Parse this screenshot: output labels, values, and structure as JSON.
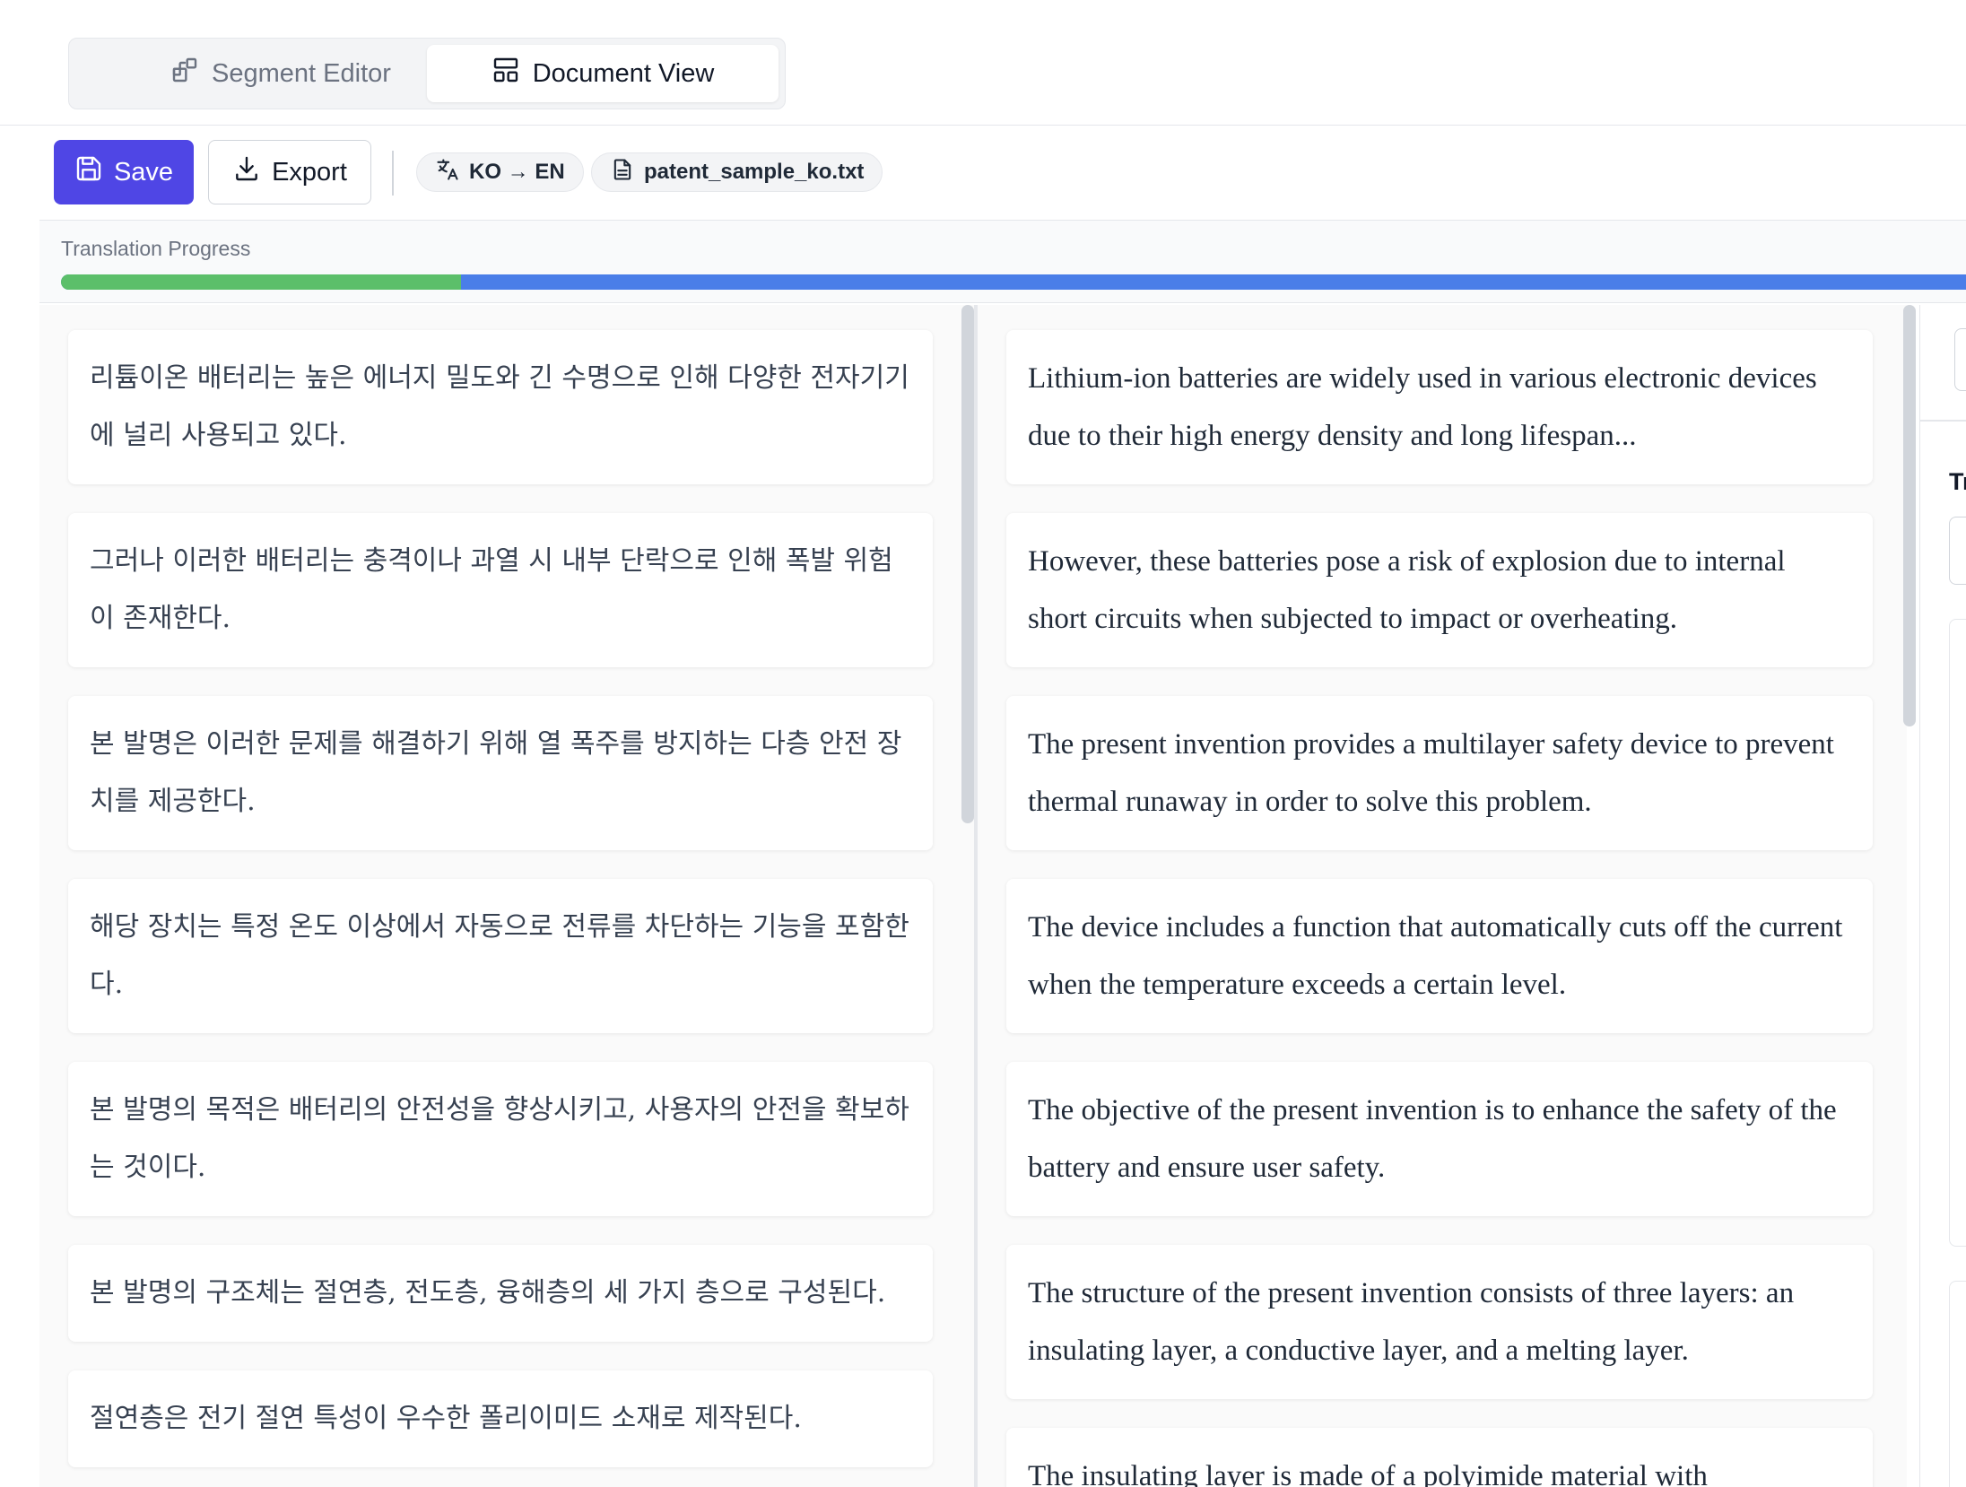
{
  "tabs": {
    "segment_editor": {
      "label": "Segment Editor",
      "icon": "segment-grid-icon"
    },
    "document_view": {
      "label": "Document View",
      "icon": "document-layout-icon",
      "active": true
    }
  },
  "toolbar": {
    "save_label": "Save",
    "export_label": "Export",
    "language_pair": "KO → EN",
    "file_name": "patent_sample_ko.txt"
  },
  "progress": {
    "label": "Translation Progress",
    "completed_fraction": 0.21
  },
  "colors": {
    "accent": "#4f46e5",
    "progress_done": "#5cbf6a",
    "progress_remaining": "#4a7ee8"
  },
  "source_segments": [
    "리튬이온 배터리는 높은 에너지 밀도와 긴 수명으로 인해 다양한 전자기기에 널리 사용되고 있다.",
    "그러나 이러한 배터리는 충격이나 과열 시 내부 단락으로 인해 폭발 위험이 존재한다.",
    "본 발명은 이러한 문제를 해결하기 위해 열 폭주를 방지하는 다층 안전 장치를 제공한다.",
    "해당 장치는 특정 온도 이상에서 자동으로 전류를 차단하는 기능을 포함한다.",
    "본 발명의 목적은 배터리의 안전성을 향상시키고, 사용자의 안전을 확보하는 것이다.",
    "본 발명의 구조체는 절연층, 전도층, 융해층의 세 가지 층으로 구성된다.",
    "절연층은 전기 절연 특성이 우수한 폴리이미드 소재로 제작된다."
  ],
  "target_segments": [
    "Lithium-ion batteries are widely used in various electronic devices due to their high energy density and long lifespan...",
    "However, these batteries pose a risk of explosion due to internal short circuits when subjected to impact or overheating.",
    "The present invention provides a multilayer safety device to prevent thermal runaway in order to solve this problem.",
    "The device includes a function that automatically cuts off the current when the temperature exceeds a certain level.",
    "The objective of the present invention is to enhance the safety of the battery and ensure user safety.",
    "The structure of the present invention consists of three layers: an insulating layer, a conductive layer, and a melting layer.",
    "The insulating layer is made of a polyimide material with"
  ],
  "sidebar": {
    "heading_fragment": "Tr"
  }
}
